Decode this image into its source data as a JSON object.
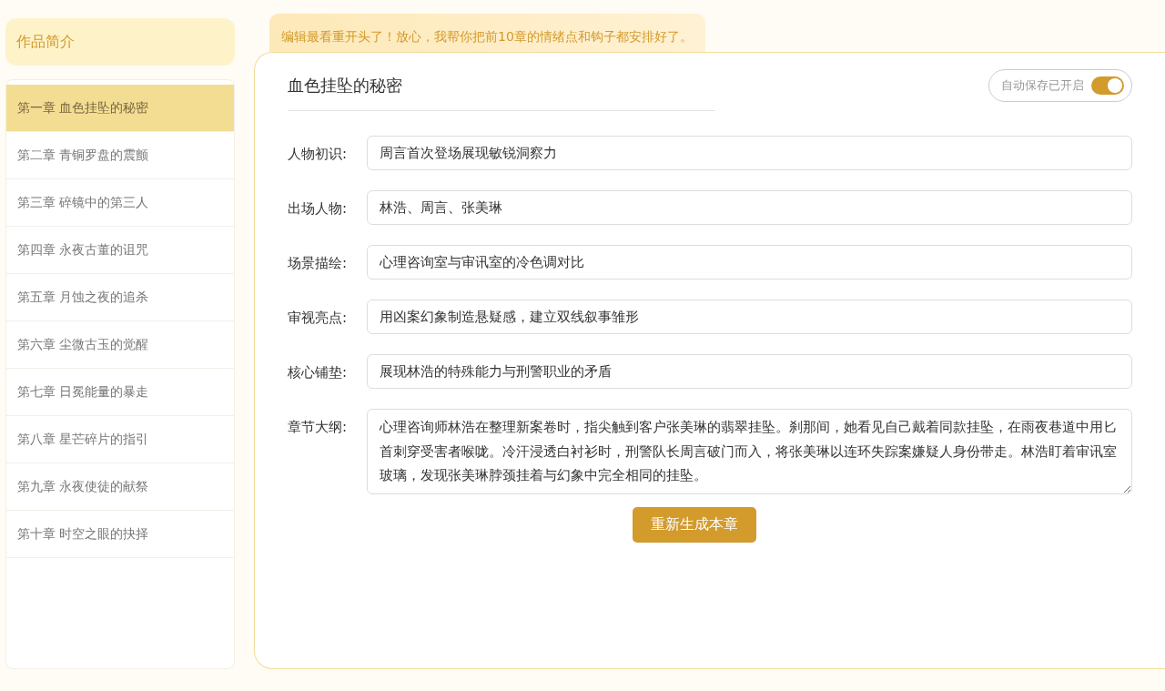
{
  "sidebar": {
    "intro_button": "作品简介",
    "chapters": [
      {
        "title": "第一章 血色挂坠的秘密",
        "selected": true
      },
      {
        "title": "第二章 青铜罗盘的震颤",
        "selected": false
      },
      {
        "title": "第三章 碎镜中的第三人",
        "selected": false
      },
      {
        "title": "第四章 永夜古董的诅咒",
        "selected": false
      },
      {
        "title": "第五章 月蚀之夜的追杀",
        "selected": false
      },
      {
        "title": "第六章 尘微古玉的觉醒",
        "selected": false
      },
      {
        "title": "第七章 日冕能量的暴走",
        "selected": false
      },
      {
        "title": "第八章 星芒碎片的指引",
        "selected": false
      },
      {
        "title": "第九章 永夜使徒的献祭",
        "selected": false
      },
      {
        "title": "第十章 时空之眼的抉择",
        "selected": false
      }
    ]
  },
  "banner": "编辑最看重开头了！放心，我帮你把前10章的情绪点和钩子都安排好了。",
  "editor": {
    "title": "血色挂坠的秘密",
    "autosave": {
      "label": "自动保存已开启",
      "on": true
    },
    "fields": [
      {
        "kind": "line",
        "label": "人物初识:",
        "value": "周言首次登场展现敏锐洞察力"
      },
      {
        "kind": "line",
        "label": "出场人物:",
        "value": "林浩、周言、张美琳"
      },
      {
        "kind": "line",
        "label": "场景描绘:",
        "value": "心理咨询室与审讯室的冷色调对比"
      },
      {
        "kind": "line",
        "label": "审视亮点:",
        "value": "用凶案幻象制造悬疑感，建立双线叙事雏形"
      },
      {
        "kind": "line",
        "label": "核心铺垫:",
        "value": "展现林浩的特殊能力与刑警职业的矛盾"
      },
      {
        "kind": "multiline",
        "label": "章节大纲:",
        "value": "心理咨询师林浩在整理新案卷时，指尖触到客户张美琳的翡翠挂坠。刹那间，她看见自己戴着同款挂坠，在雨夜巷道中用匕首刺穿受害者喉咙。冷汗浸透白衬衫时，刑警队长周言破门而入，将张美琳以连环失踪案嫌疑人身份带走。林浩盯着审讯室玻璃，发现张美琳脖颈挂着与幻象中完全相同的挂坠。"
      }
    ],
    "regenerate_button": "重新生成本章"
  }
}
